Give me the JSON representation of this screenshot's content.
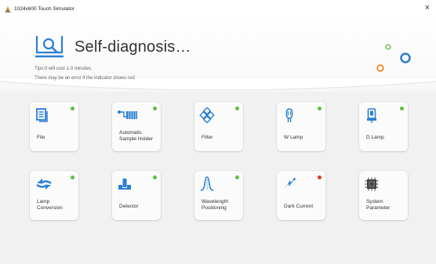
{
  "window": {
    "title": "1024x600 Touch Simulator",
    "close_symbol": "×"
  },
  "header": {
    "heading": "Self-diagnosis…",
    "tip_line1": "Tips:It will cost 1-3 minutes.",
    "tip_line2": "There may be an error if the indicator shows red"
  },
  "colors": {
    "status_ok": "#5fbf3f",
    "status_error": "#e23a2e",
    "accent_blue": "#2a7fd4",
    "accent_orange": "#f08a2a",
    "accent_green": "#6ac24b"
  },
  "cards": [
    {
      "label": "File",
      "icon": "file-icon",
      "status": "ok"
    },
    {
      "label": "Automatic Sample Holder",
      "icon": "sample-holder-icon",
      "status": "ok"
    },
    {
      "label": "Filter",
      "icon": "filter-icon",
      "status": "ok"
    },
    {
      "label": "W Lamp",
      "icon": "w-lamp-icon",
      "status": "ok"
    },
    {
      "label": "D Lamp",
      "icon": "d-lamp-icon",
      "status": "ok"
    },
    {
      "label": "Lamp Conversion",
      "icon": "lamp-conversion-icon",
      "status": "ok"
    },
    {
      "label": "Detector",
      "icon": "detector-icon",
      "status": "ok"
    },
    {
      "label": "Wavelength Positioning",
      "icon": "wavelength-icon",
      "status": "ok"
    },
    {
      "label": "Dark Current",
      "icon": "dark-current-icon",
      "status": "error"
    },
    {
      "label": "System Parameter",
      "icon": "system-parameter-icon",
      "status": "none"
    }
  ]
}
